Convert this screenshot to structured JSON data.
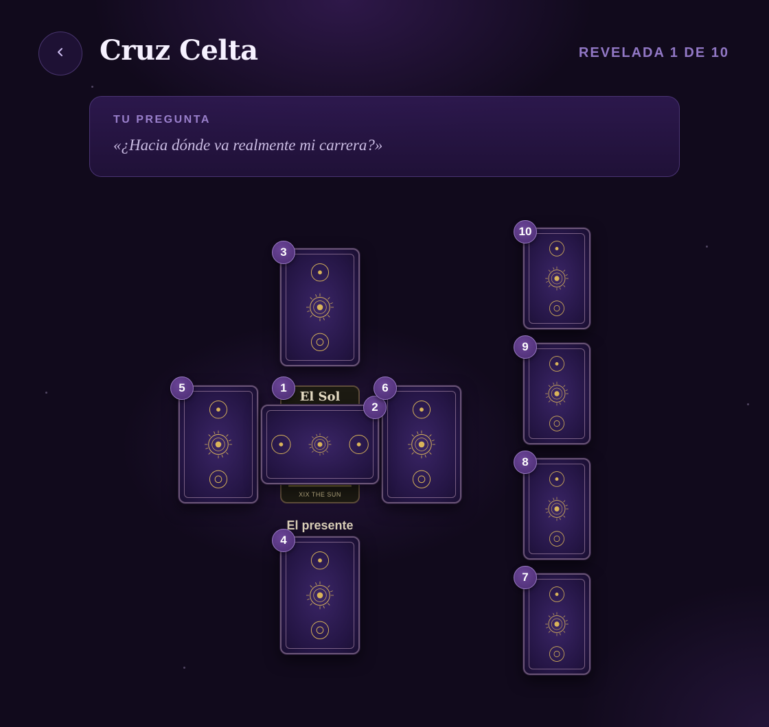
{
  "header": {
    "title": "Cruz Celta",
    "progress": "REVELADA 1 DE 10"
  },
  "question": {
    "heading": "TU PREGUNTA",
    "text": "«¿Hacia dónde va realmente mi carrera?»"
  },
  "spread": {
    "cards": [
      {
        "number": "1",
        "revealed": true,
        "name": "El Sol",
        "caption": "XIX THE SUN",
        "position_label": "El presente"
      },
      {
        "number": "2",
        "revealed": false
      },
      {
        "number": "3",
        "revealed": false
      },
      {
        "number": "4",
        "revealed": false
      },
      {
        "number": "5",
        "revealed": false
      },
      {
        "number": "6",
        "revealed": false
      },
      {
        "number": "7",
        "revealed": false
      },
      {
        "number": "8",
        "revealed": false
      },
      {
        "number": "9",
        "revealed": false
      },
      {
        "number": "10",
        "revealed": false
      }
    ]
  },
  "colors": {
    "background": "#110a1c",
    "accent": "#9278c6",
    "badge": "#5a3a86",
    "card_gold": "#d9b45a"
  },
  "icons": {
    "back": "chevron-left-icon"
  }
}
